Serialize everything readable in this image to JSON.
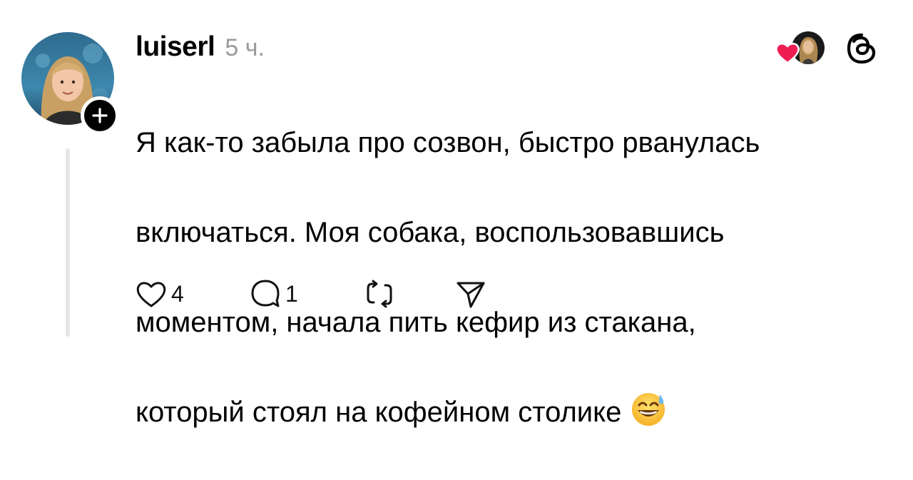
{
  "post": {
    "username": "luiserl",
    "timestamp": "5 ч.",
    "body_lines": [
      "Я как-то забыла про созвон, быстро рванулась",
      "включаться. Моя собака, воспользовавшись",
      "моментом, начала пить кефир из стакана,",
      "который стоял на кофейном столике"
    ],
    "trailing_emoji": "grinning-face-with-sweat-emoji"
  },
  "actions": {
    "likes_count": "4",
    "replies_count": "1"
  },
  "icons": {
    "like": "heart-outline-icon",
    "reply": "speech-bubble-icon",
    "repost": "repost-arrows-icon",
    "share": "paper-plane-icon",
    "threads_logo": "threads-logo-icon",
    "follow": "plus-icon",
    "liked_by": "heart-filled-icon"
  },
  "colors": {
    "text": "#000000",
    "timestamp": "#9a9a9a",
    "heart_red": "#ee1d52",
    "thread_line": "#e6e6e6"
  }
}
